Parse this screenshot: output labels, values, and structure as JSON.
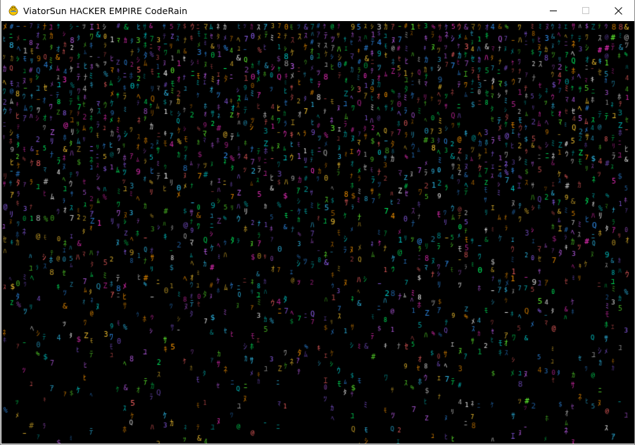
{
  "window": {
    "title": "ViatorSun HACKER EMPIRE CodeRain",
    "icon": "pygame-snake-icon",
    "controls": [
      "minimize-icon",
      "maximize-icon",
      "close-icon"
    ]
  },
  "canvas": {
    "background": "#000000",
    "palette": [
      "#00ff66",
      "#33ccff",
      "#ff33cc",
      "#ffcc33",
      "#9966ff",
      "#00cccc",
      "#ff6666",
      "#66ff33",
      "#ff9900",
      "#cc66ff",
      "#3399ff",
      "#ffffff"
    ]
  }
}
